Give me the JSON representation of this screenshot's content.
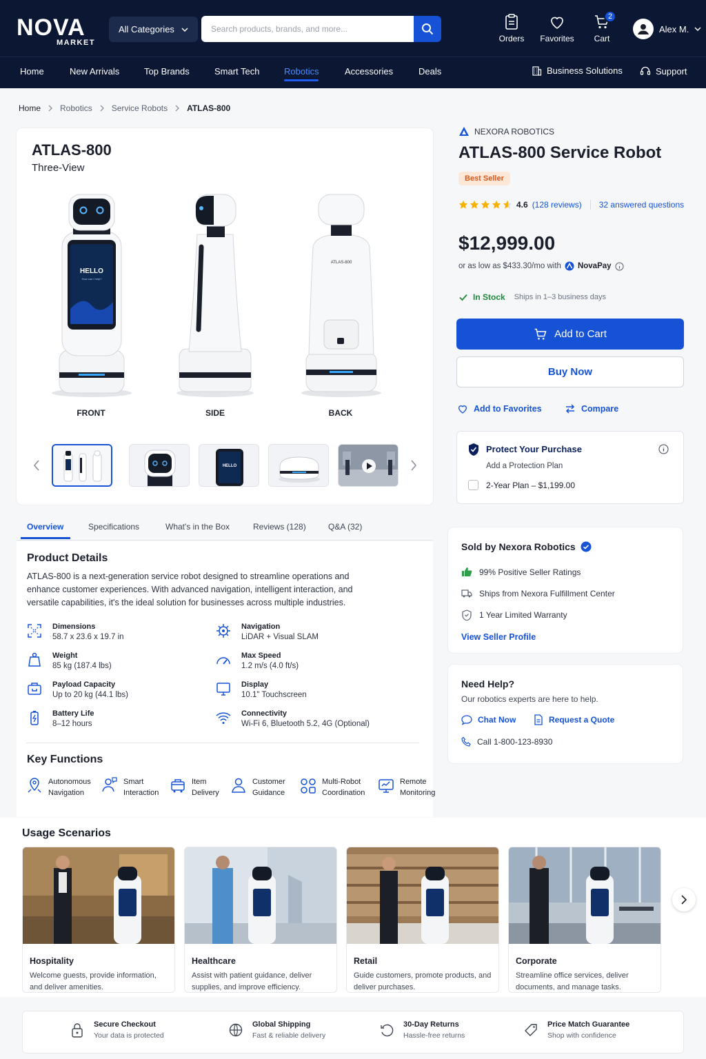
{
  "header": {
    "logo_main": "NOVA",
    "logo_sub": "MARKET",
    "categories_label": "All Categories",
    "search_placeholder": "Search products, brands, and more...",
    "orders_label": "Orders",
    "favorites_label": "Favorites",
    "cart_label": "Cart",
    "cart_count": "2",
    "user_name": "Alex M."
  },
  "nav": {
    "items": [
      "Home",
      "New Arrivals",
      "Top Brands",
      "Smart Tech",
      "Robotics",
      "Accessories",
      "Deals"
    ],
    "active": "Robotics",
    "business": "Business Solutions",
    "support": "Support"
  },
  "breadcrumb": [
    "Home",
    "Robotics",
    "Service Robots",
    "ATLAS-800"
  ],
  "gallery": {
    "title": "ATLAS-800",
    "subtitle": "Three-View",
    "views": [
      "FRONT",
      "SIDE",
      "BACK"
    ],
    "screen_text": "HELLO",
    "screen_subtext": "How can I help?",
    "back_label": "ATLAS-800",
    "thumbnails": [
      "three-view",
      "face",
      "screen",
      "base",
      "video"
    ]
  },
  "tabs": [
    "Overview",
    "Specifications",
    "What's in the Box",
    "Reviews (128)",
    "Q&A (32)"
  ],
  "details": {
    "heading": "Product Details",
    "description": "ATLAS-800 is a next-generation service robot designed to streamline operations and enhance customer experiences. With advanced navigation, intelligent interaction, and versatile capabilities, it's the ideal solution for businesses across multiple industries.",
    "specs": [
      {
        "label": "Dimensions",
        "value": "58.7 x 23.6 x 19.7 in",
        "icon": "dimensions-icon"
      },
      {
        "label": "Weight",
        "value": "85 kg (187.4 lbs)",
        "icon": "weight-icon"
      },
      {
        "label": "Payload Capacity",
        "value": "Up to 20 kg (44.1 lbs)",
        "icon": "payload-icon"
      },
      {
        "label": "Battery Life",
        "value": "8–12 hours",
        "icon": "battery-icon"
      },
      {
        "label": "Navigation",
        "value": "LiDAR + Visual SLAM",
        "icon": "navigation-icon"
      },
      {
        "label": "Max Speed",
        "value": "1.2 m/s (4.0 ft/s)",
        "icon": "speed-icon"
      },
      {
        "label": "Display",
        "value": "10.1\" Touchscreen",
        "icon": "display-icon"
      },
      {
        "label": "Connectivity",
        "value": "Wi-Fi 6, Bluetooth 5.2, 4G (Optional)",
        "icon": "wifi-icon"
      }
    ],
    "key_heading": "Key Functions",
    "key_functions": [
      {
        "l1": "Autonomous",
        "l2": "Navigation"
      },
      {
        "l1": "Smart",
        "l2": "Interaction"
      },
      {
        "l1": "Item",
        "l2": "Delivery"
      },
      {
        "l1": "Customer",
        "l2": "Guidance"
      },
      {
        "l1": "Multi-Robot",
        "l2": "Coordination"
      },
      {
        "l1": "Remote",
        "l2": "Monitoring"
      }
    ]
  },
  "product": {
    "brand": "NEXORA ROBOTICS",
    "title": "ATLAS-800 Service Robot",
    "badge": "Best Seller",
    "rating": "4.6",
    "rating_value": 4.6,
    "reviews": "(128 reviews)",
    "questions": "32 answered questions",
    "price": "$12,999.00",
    "finance_text": "or as low as $433.30/mo with",
    "finance_brand": "NovaPay",
    "stock": "In Stock",
    "ships": "Ships in 1–3 business days",
    "add_to_cart": "Add to Cart",
    "buy_now": "Buy Now",
    "add_favorites": "Add to Favorites",
    "compare": "Compare",
    "protect_title": "Protect Your Purchase",
    "protect_sub": "Add a Protection Plan",
    "protect_plan": "2-Year Plan – $1,199.00"
  },
  "seller": {
    "title": "Sold by Nexora Robotics",
    "ratings": "99% Positive Seller Ratings",
    "ships_from": "Ships from Nexora Fulfillment Center",
    "warranty": "1 Year Limited Warranty",
    "link": "View Seller Profile"
  },
  "help": {
    "title": "Need Help?",
    "subtitle": "Our robotics experts are here to help.",
    "chat": "Chat Now",
    "quote": "Request a Quote",
    "phone": "Call 1-800-123-8930"
  },
  "usage": {
    "heading": "Usage Scenarios",
    "items": [
      {
        "title": "Hospitality",
        "desc": "Welcome guests, provide information, and deliver amenities."
      },
      {
        "title": "Healthcare",
        "desc": "Assist with patient guidance, deliver supplies, and improve efficiency."
      },
      {
        "title": "Retail",
        "desc": "Guide customers, promote products, and deliver purchases."
      },
      {
        "title": "Corporate",
        "desc": "Streamline office services, deliver documents, and manage tasks."
      }
    ]
  },
  "trust": [
    {
      "title": "Secure Checkout",
      "sub": "Your data is protected"
    },
    {
      "title": "Global Shipping",
      "sub": "Fast & reliable delivery"
    },
    {
      "title": "30-Day Returns",
      "sub": "Hassle-free returns"
    },
    {
      "title": "Price Match Guarantee",
      "sub": "Shop with confidence"
    }
  ],
  "colors": {
    "primary": "#1552d6",
    "header": "#0b1733",
    "badge_bg": "#fde8d8",
    "badge_text": "#d9581c",
    "stars": "#f5b301",
    "success": "#1d8a3a"
  }
}
